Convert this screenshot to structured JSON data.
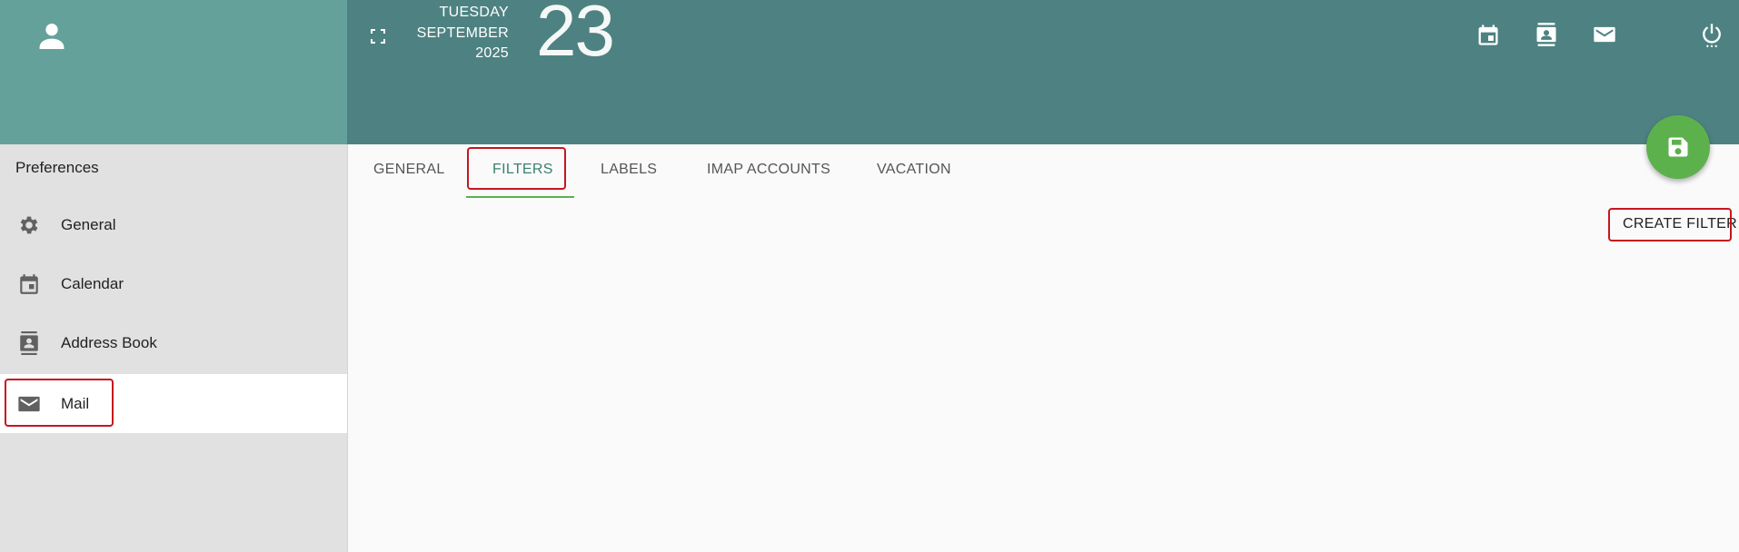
{
  "header": {
    "weekday": "TUESDAY",
    "month": "SEPTEMBER",
    "year": "2025",
    "day": "23",
    "icons": [
      "calendar-icon",
      "address-book-icon",
      "mail-icon",
      "power-icon"
    ]
  },
  "sidebar": {
    "title": "Preferences",
    "items": [
      {
        "label": "General",
        "icon": "gear-icon"
      },
      {
        "label": "Calendar",
        "icon": "calendar-icon"
      },
      {
        "label": "Address Book",
        "icon": "address-book-icon"
      },
      {
        "label": "Mail",
        "icon": "mail-icon"
      }
    ]
  },
  "tabs": {
    "items": [
      {
        "label": "GENERAL"
      },
      {
        "label": "FILTERS"
      },
      {
        "label": "LABELS"
      },
      {
        "label": "IMAP ACCOUNTS"
      },
      {
        "label": "VACATION"
      }
    ],
    "active": "FILTERS"
  },
  "main": {
    "create_filter_label": "CREATE FILTER"
  },
  "colors": {
    "sidebar_header": "#64a19b",
    "header": "#4e8282",
    "accent": "#5cb14d",
    "highlight": "#c4171f"
  }
}
